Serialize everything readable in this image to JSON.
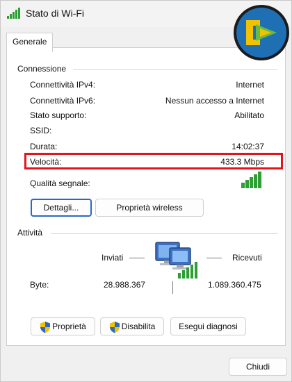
{
  "window": {
    "title": "Stato di Wi-Fi"
  },
  "tabs": [
    {
      "label": "Generale"
    }
  ],
  "connection": {
    "section_label": "Connessione",
    "rows": [
      {
        "label": "Connettività IPv4:",
        "value": "Internet"
      },
      {
        "label": "Connettività IPv6:",
        "value": "Nessun accesso a Internet"
      },
      {
        "label": "Stato supporto:",
        "value": "Abilitato"
      },
      {
        "label": "SSID:",
        "value": ""
      },
      {
        "label": "Durata:",
        "value": "14:02:37"
      },
      {
        "label": "Velocità:",
        "value": "433.3 Mbps"
      }
    ],
    "signal_quality_label": "Qualità segnale:",
    "signal_bars_lit": 5,
    "signal_bars_total": 5,
    "details_button": "Dettagli...",
    "wireless_properties_button": "Proprietà wireless"
  },
  "activity": {
    "section_label": "Attività",
    "sent_label": "Inviati",
    "received_label": "Ricevuti",
    "bytes_label": "Byte:",
    "bytes_sent": "28.988.367",
    "bytes_received": "1.089.360.475"
  },
  "actions": {
    "properties_button": "Proprietà",
    "disable_button": "Disabilita",
    "diagnose_button": "Esegui diagnosi"
  },
  "footer": {
    "close_button": "Chiudi"
  },
  "colors": {
    "highlight_box": "#e3141b",
    "signal_green": "#2e9e35",
    "primary_button_border": "#2a6ac2",
    "logo_blue": "#1f6fb5",
    "logo_yellow": "#f2c200",
    "logo_green": "#6dbf3b"
  },
  "icons": {
    "title": "wifi-signal-icon",
    "logo": "brand-logo-icon",
    "network": "network-computers-icon",
    "shield": "uac-shield-icon"
  }
}
